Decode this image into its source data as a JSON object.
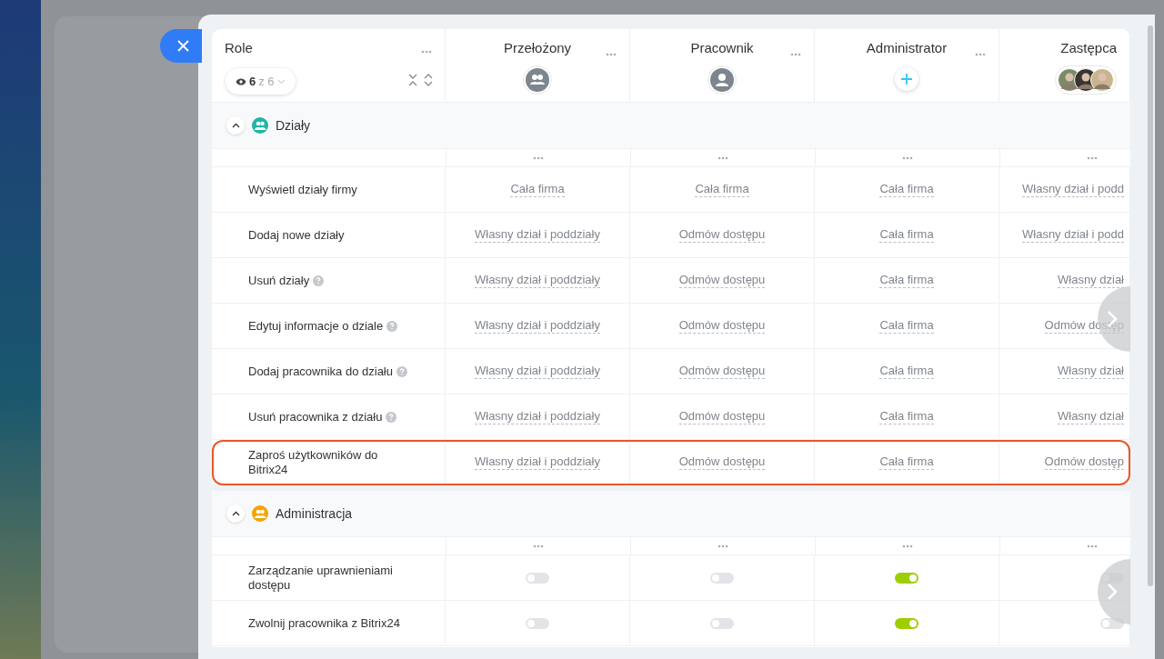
{
  "columns": [
    {
      "title": "Przełożony",
      "kind": "group"
    },
    {
      "title": "Pracownik",
      "kind": "user"
    },
    {
      "title": "Administrator",
      "kind": "add"
    },
    {
      "title": "Zastępca",
      "kind": "photos"
    }
  ],
  "role_header": {
    "title": "Role",
    "shown": "6",
    "total": "z 6"
  },
  "groups": [
    {
      "title": "Działy",
      "color": "#1fb5a6",
      "expanded": true,
      "rows": [
        {
          "label": "Wyświetl działy firmy",
          "help": false,
          "highlighted": false,
          "kind": "select",
          "values": [
            "Cała firma",
            "Cała firma",
            "Cała firma",
            "Własny dział i podd"
          ]
        },
        {
          "label": "Dodaj nowe działy",
          "help": false,
          "highlighted": false,
          "kind": "select",
          "values": [
            "Własny dział i poddziały",
            "Odmów dostępu",
            "Cała firma",
            "Własny dział i podd"
          ]
        },
        {
          "label": "Usuń działy",
          "help": true,
          "highlighted": false,
          "kind": "select",
          "values": [
            "Własny dział i poddziały",
            "Odmów dostępu",
            "Cała firma",
            "Własny dział"
          ]
        },
        {
          "label": "Edytuj informacje o dziale",
          "help": true,
          "highlighted": false,
          "kind": "select",
          "values": [
            "Własny dział i poddziały",
            "Odmów dostępu",
            "Cała firma",
            "Odmów dostęp"
          ]
        },
        {
          "label": "Dodaj pracownika do działu",
          "help": true,
          "highlighted": false,
          "kind": "select",
          "values": [
            "Własny dział i poddziały",
            "Odmów dostępu",
            "Cała firma",
            "Własny dział"
          ]
        },
        {
          "label": "Usuń pracownika z działu",
          "help": true,
          "highlighted": false,
          "kind": "select",
          "values": [
            "Własny dział i poddziały",
            "Odmów dostępu",
            "Cała firma",
            "Własny dział"
          ]
        },
        {
          "label": "Zaproś użytkowników do Bitrix24",
          "help": false,
          "highlighted": true,
          "kind": "select",
          "values": [
            "Własny dział i poddziały",
            "Odmów dostępu",
            "Cała firma",
            "Odmów dostęp"
          ]
        }
      ]
    },
    {
      "title": "Administracja",
      "color": "#f5a300",
      "expanded": true,
      "rows": [
        {
          "label": "Zarządzanie uprawnieniami dostępu",
          "help": false,
          "highlighted": false,
          "kind": "toggle",
          "values": [
            false,
            false,
            true,
            false
          ]
        },
        {
          "label": "Zwolnij pracownika z Bitrix24",
          "help": false,
          "highlighted": false,
          "kind": "toggle",
          "values": [
            false,
            false,
            true,
            false
          ]
        }
      ]
    }
  ]
}
